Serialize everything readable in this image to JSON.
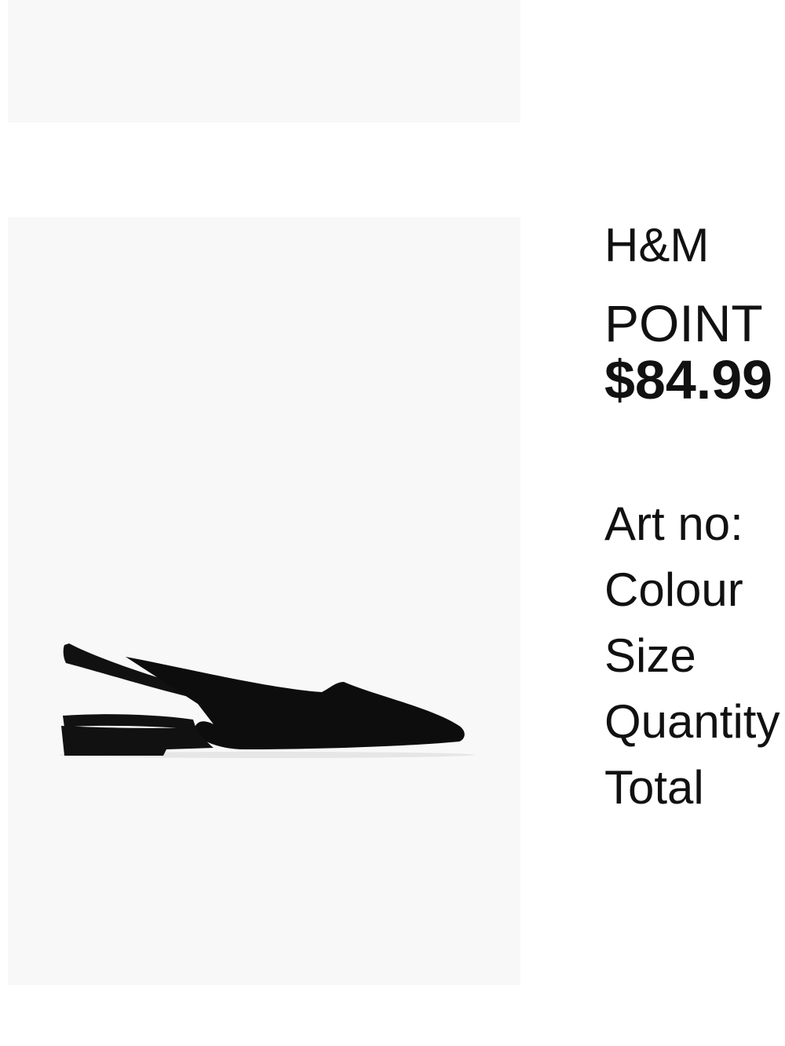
{
  "item": {
    "brand": "H&M",
    "name": "POINT",
    "price": "$84.99",
    "image_alt": "Black pointed slingback flat shoe"
  },
  "details": {
    "art_no_label": "Art no:",
    "colour_label": "Colour",
    "size_label": "Size",
    "quantity_label": "Quantity",
    "total_label": "Total"
  }
}
